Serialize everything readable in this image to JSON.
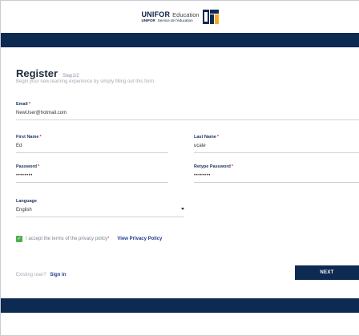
{
  "header": {
    "brand_line1_bold": "UNIFOR",
    "brand_line1_text": "Education",
    "brand_line2_bold": "UNIFOR",
    "brand_line2_text": "Service de l'éducation"
  },
  "form": {
    "title": "Register",
    "step": "Step1/2",
    "subtitle": "Begin your new learning experience by simply filling out this form.",
    "email": {
      "label": "Email",
      "value": "NewUser@hotmail.com"
    },
    "first_name": {
      "label": "First Name",
      "value": "Ed"
    },
    "last_name": {
      "label": "Last Name",
      "value": "ucate"
    },
    "password": {
      "label": "Password",
      "value": "••••••••"
    },
    "retype_password": {
      "label": "Retype Password",
      "value": "••••••••"
    },
    "language": {
      "label": "Language",
      "value": "English"
    },
    "terms_text": "I accept the terms of the privacy policy",
    "terms_required": "*",
    "privacy_link": "View Privacy Policy",
    "terms_checked": true,
    "existing_user": "Existing user?",
    "sign_in_link": "Sign in",
    "next_button": "NEXT"
  },
  "colors": {
    "navy": "#0d2a52",
    "check_green": "#4caf50",
    "required_red": "#d32f2f",
    "link_blue": "#1e3a8a"
  }
}
